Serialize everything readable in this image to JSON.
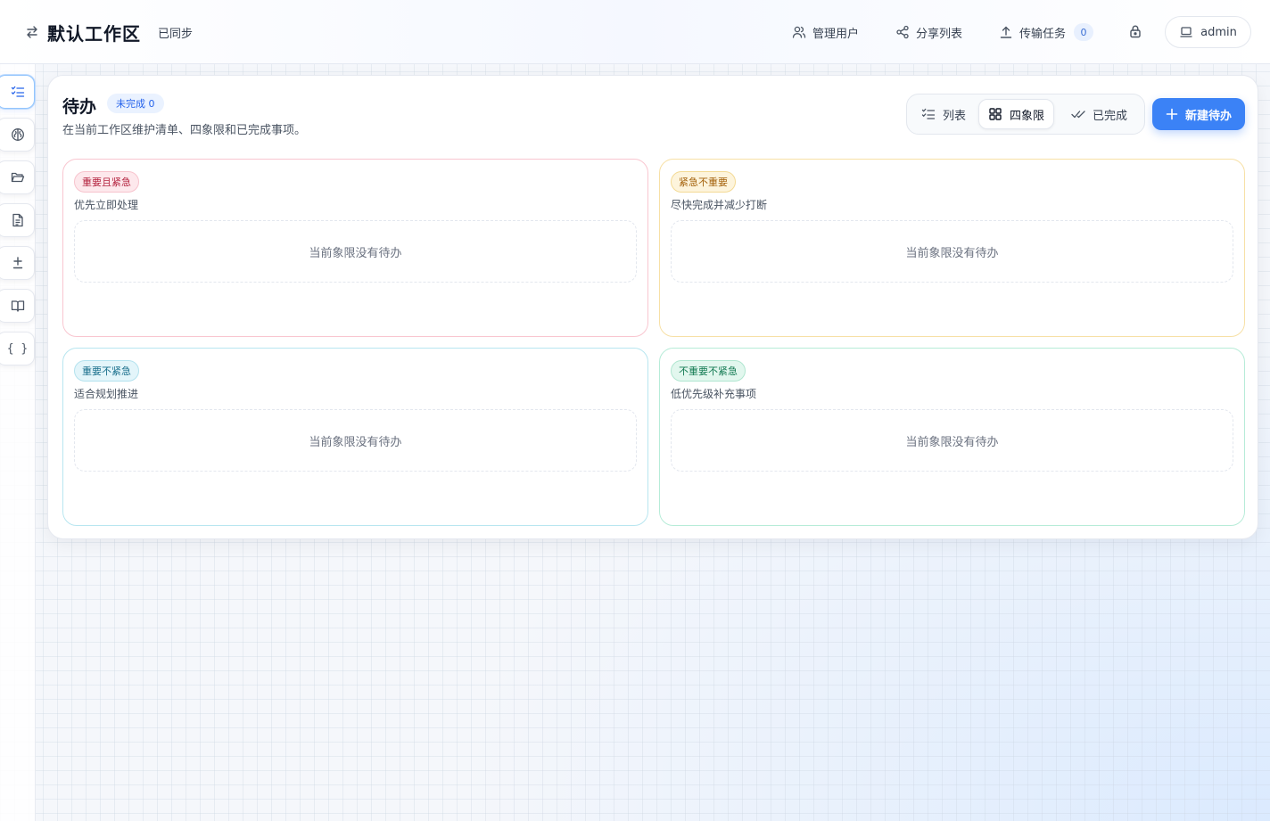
{
  "header": {
    "workspace_title": "默认工作区",
    "sync_status": "已同步",
    "manage_users": "管理用户",
    "share_list": "分享列表",
    "transfer_tasks": "传输任务",
    "transfer_count": "0",
    "user": "admin"
  },
  "sidebar": {
    "items": [
      {
        "icon": "list-checks-icon",
        "active": true
      },
      {
        "icon": "brain-icon",
        "active": false
      },
      {
        "icon": "folder-open-icon",
        "active": false
      },
      {
        "icon": "file-text-icon",
        "active": false
      },
      {
        "icon": "plus-minus-icon",
        "active": false
      },
      {
        "icon": "book-open-icon",
        "active": false
      },
      {
        "icon": "braces-icon",
        "active": false,
        "glyph": "{ }"
      }
    ]
  },
  "main": {
    "title": "待办",
    "pending_badge": "未完成 0",
    "subtitle": "在当前工作区维护清单、四象限和已完成事项。",
    "views": [
      {
        "label": "列表",
        "active": false
      },
      {
        "label": "四象限",
        "active": true
      },
      {
        "label": "已完成",
        "active": false
      }
    ],
    "new_button": "新建待办",
    "accent_color": "#3b82f6"
  },
  "quadrants": [
    {
      "tag": "重要且紧急",
      "desc": "优先立即处理",
      "empty": "当前象限没有待办",
      "color": "#b4233f"
    },
    {
      "tag": "紧急不重要",
      "desc": "尽快完成并减少打断",
      "empty": "当前象限没有待办",
      "color": "#a4610b"
    },
    {
      "tag": "重要不紧急",
      "desc": "适合规划推进",
      "empty": "当前象限没有待办",
      "color": "#1a6f8c"
    },
    {
      "tag": "不重要不紧急",
      "desc": "低优先级补充事项",
      "empty": "当前象限没有待办",
      "color": "#137a52"
    }
  ]
}
